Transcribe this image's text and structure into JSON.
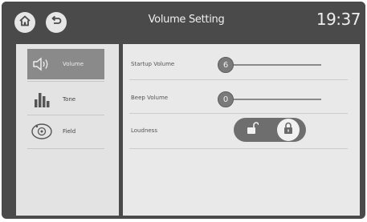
{
  "header": {
    "title": "Volume Setting",
    "time": "19:37"
  },
  "sidebar": {
    "items": [
      {
        "label": "Volume",
        "icon": "speaker-icon",
        "active": true
      },
      {
        "label": "Tone",
        "icon": "equalizer-icon",
        "active": false
      },
      {
        "label": "Field",
        "icon": "sound-field-icon",
        "active": false
      }
    ]
  },
  "settings": {
    "startup_volume": {
      "label": "Startup Volume",
      "value": "6"
    },
    "beep_volume": {
      "label": "Beep Volume",
      "value": "0"
    },
    "loudness": {
      "label": "Loudness",
      "state": "on"
    }
  },
  "colors": {
    "header_bg": "#4a4a4a",
    "panel_bg": "#e9e9e9",
    "active_item": "#8a8a8a"
  }
}
